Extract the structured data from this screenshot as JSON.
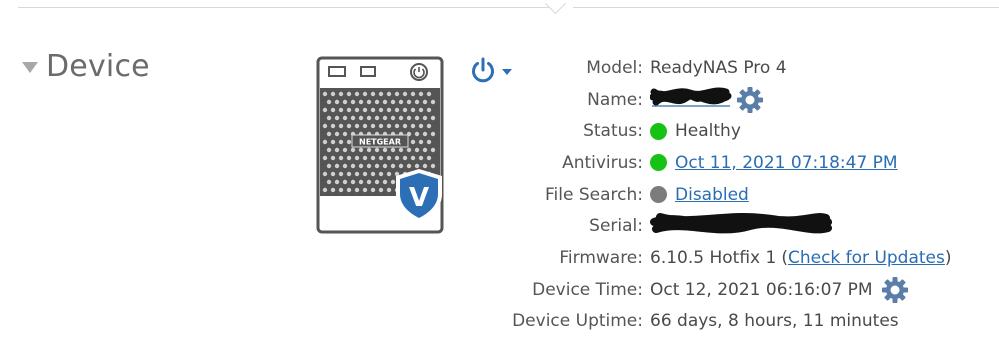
{
  "section": {
    "title": "Device"
  },
  "device": {
    "brand": "NETGEAR",
    "shield_letter": "V"
  },
  "info": {
    "rows": [
      {
        "label": "Model:",
        "value": "ReadyNAS Pro 4"
      },
      {
        "label": "Name:",
        "value": ""
      },
      {
        "label": "Status:",
        "value": "Healthy",
        "indicator": "green"
      },
      {
        "label": "Antivirus:",
        "value": "Oct 11, 2021 07:18:47 PM",
        "indicator": "green"
      },
      {
        "label": "File Search:",
        "value": "Disabled",
        "indicator": "gray"
      },
      {
        "label": "Serial:",
        "value": ""
      },
      {
        "label": "Firmware:",
        "value": "6.10.5 Hotfix 1",
        "open_paren": "(",
        "link": "Check for Updates",
        "close_paren": ")"
      },
      {
        "label": "Device Time:",
        "value": "Oct 12, 2021 06:16:07 PM"
      },
      {
        "label": "Device Uptime:",
        "value": "66 days, 8 hours, 11 minutes"
      }
    ]
  },
  "icons": {
    "power": "power-icon",
    "gear": "gear-icon",
    "chevron": "chevron-down-icon",
    "collapse": "triangle-down-icon"
  },
  "colors": {
    "link": "#2a6db3",
    "status_green": "#16c216",
    "status_gray": "#7c7c7c",
    "power_blue": "#2c6fb6",
    "gear_blue": "#5a7ea8"
  }
}
